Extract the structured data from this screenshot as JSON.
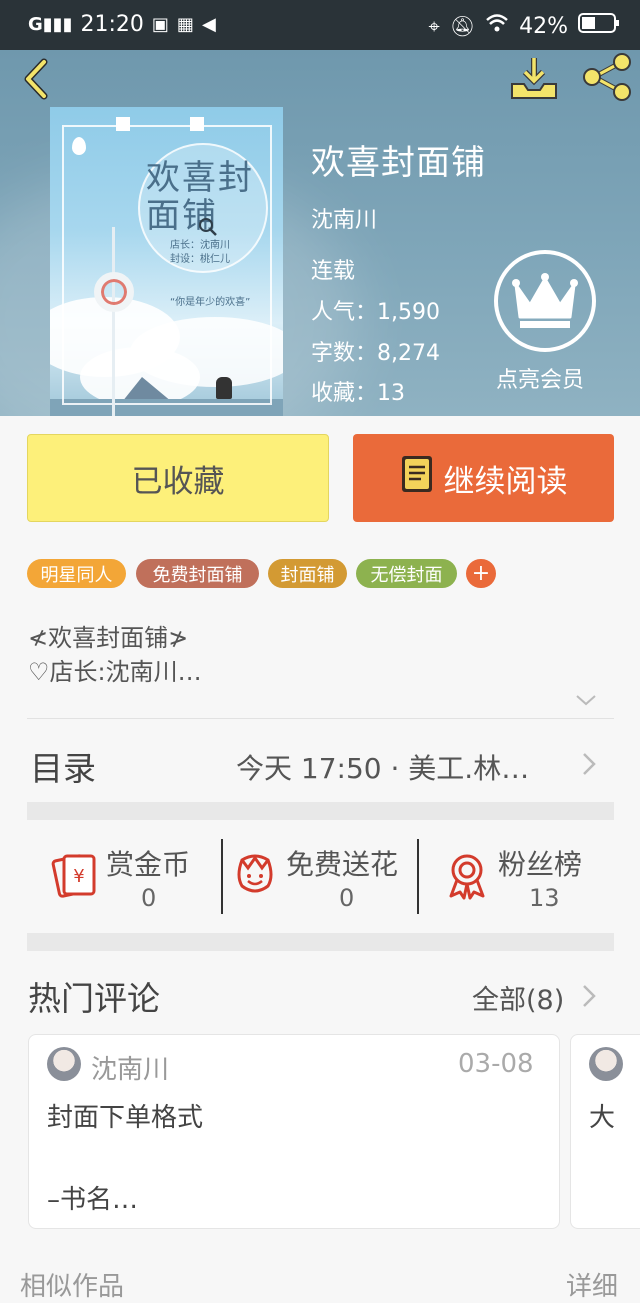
{
  "status_bar": {
    "time": "21:20",
    "battery": "42%"
  },
  "header": {
    "cover_title": "欢喜封面铺",
    "cover_meta": "店长：沈南川\n封设：桃仁儿",
    "cover_quote": "“你是年少的欢喜”"
  },
  "book": {
    "title": "欢喜封面铺",
    "author": "沈南川",
    "status": "连载",
    "popularity": "人气：1,590",
    "word_count": "字数：8,274",
    "favorites": "收藏：13",
    "vip_label": "点亮会员"
  },
  "actions": {
    "collected_label": "已收藏",
    "continue_label": "继续阅读"
  },
  "tags": [
    "明星同人",
    "免费封面铺",
    "封面铺",
    "无偿封面"
  ],
  "description": {
    "line1": "≮欢喜封面铺≯",
    "line2": "♡店长:沈南川…"
  },
  "toc": {
    "label": "目录",
    "latest": "今天 17:50 · 美工.林…"
  },
  "stats": [
    {
      "label": "赏金币",
      "value": "0",
      "icon": "red-envelope-icon"
    },
    {
      "label": "免费送花",
      "value": "0",
      "icon": "flower-icon"
    },
    {
      "label": "粉丝榜",
      "value": "13",
      "icon": "medal-icon"
    }
  ],
  "comments": {
    "title": "热门评论",
    "all_label": "全部(8)",
    "items": [
      {
        "user": "沈南川",
        "date": "03-08",
        "line1": "封面下单格式",
        "line2": "–书名…"
      },
      {
        "user": "",
        "date": "",
        "line1": "大",
        "line2": ""
      }
    ]
  },
  "bottom": {
    "left": "相似作品",
    "right": "详细"
  },
  "colors": {
    "status_bar": "#2a3338",
    "hero": "#7fa6b9",
    "collected_bg": "#fdf07a",
    "continue_bg": "#ea6a3a",
    "tag_colors": [
      "#f3a637",
      "#c0705b",
      "#d39a33",
      "#8db24f"
    ],
    "add_tag": "#ea6a3a"
  }
}
